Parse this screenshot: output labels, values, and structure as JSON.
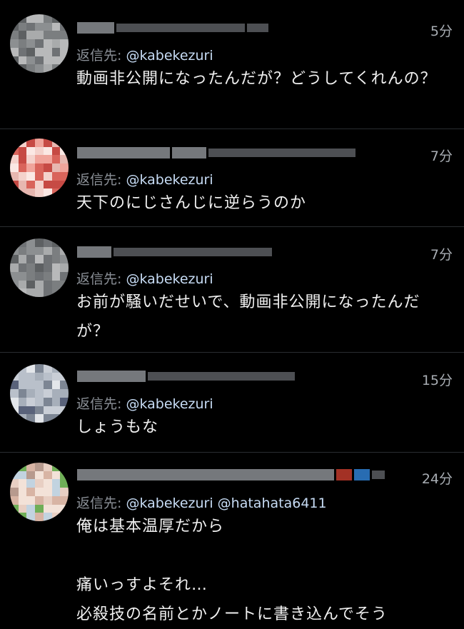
{
  "replies": [
    {
      "time": "5分",
      "reply_label": "返信先:",
      "reply_handles": "@kabekezuri",
      "body": "動画非公開になったんだが？どうしてくれんの？",
      "avatar_colors": [
        "#6f7275",
        "#8c8f91",
        "#a9abac",
        "#5d6062",
        "#b8b9ba",
        "#7b7e80"
      ]
    },
    {
      "time": "7分",
      "reply_label": "返信先:",
      "reply_handles": "@kabekezuri",
      "body": "天下のにじさんじに逆らうのか",
      "avatar_colors": [
        "#e7b7b0",
        "#f4d2cc",
        "#d9645b",
        "#f0a49b",
        "#fbe8e4",
        "#c64a44"
      ]
    },
    {
      "time": "7分",
      "reply_label": "返信先:",
      "reply_handles": "@kabekezuri",
      "body": "お前が騒いだせいで、動画非公開になったんだが？",
      "avatar_colors": [
        "#6f7275",
        "#8c8f91",
        "#a9abac",
        "#5d6062",
        "#b8b9ba",
        "#7b7e80"
      ]
    },
    {
      "time": "15分",
      "reply_label": "返信先:",
      "reply_handles": "@kabekezuri",
      "body": "しょうもな",
      "avatar_colors": [
        "#c9ced6",
        "#a7afba",
        "#e3e6ea",
        "#7d8694",
        "#59627a",
        "#b9c0ca"
      ]
    },
    {
      "time": "24分",
      "reply_label": "返信先:",
      "reply_handles": "@kabekezuri @hatahata6411",
      "body": "俺は基本温厚だから\n\n痛いっすよそれ…\n必殺技の名前とかノートに書き込んでそう",
      "avatar_colors": [
        "#e8cfc3",
        "#f3e2d8",
        "#b79a8e",
        "#d8b4a4",
        "#6fae57",
        "#c2d3e0"
      ]
    }
  ]
}
